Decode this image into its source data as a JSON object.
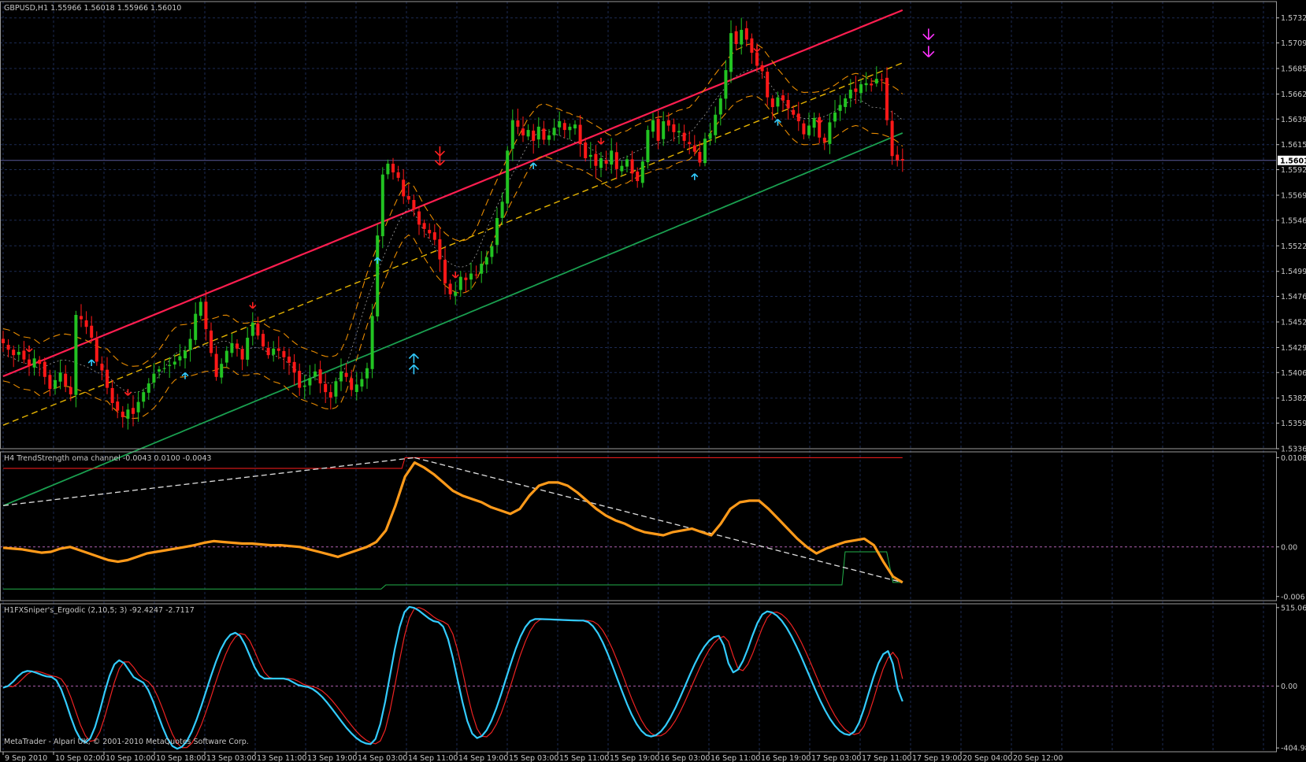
{
  "main_title": "GBPUSD,H1  1.55966 1.56018 1.55966 1.56010",
  "ind1_title": "H4 TrendStrength oma channel -0.0043 0.0100 -0.0043",
  "ind2_title": "H1FXSniper's_Ergodic  (2,10,5; 3) -92.4247 -2.7117",
  "footer": "MetaTrader - Alpari UK, © 2001-2010 MetaQuotes Software Corp.",
  "colors": {
    "background": "#000000",
    "grid": "#1c2a52",
    "axis": "#c0c0c0",
    "bull": "#22c322",
    "bear": "#ff1818",
    "ma_red": "#ff1e50",
    "ma_yellow": "#e6b400",
    "ma_green": "#1aa050",
    "band": "#e68a00",
    "midline": "#a0a0a0",
    "osc_orange": "#ff9a1a",
    "osc_level_red": "#ff1e1e",
    "osc_level_green": "#22b04a",
    "trend_white": "#e0e0e0",
    "erg_blue": "#33ccff",
    "erg_red": "#ee2222",
    "zero_line": "#b060b0",
    "up_arrow": "#33ccff",
    "down_arrow": "#ff2020",
    "magenta_arrow": "#ff33ff"
  },
  "chart_data": [
    {
      "type": "candlestick",
      "name": "GBPUSD,H1",
      "ylim": [
        1.5336,
        1.5747
      ],
      "price_ticks": [
        "1.57320",
        "1.57090",
        "1.56855",
        "1.56620",
        "1.56390",
        "1.56155",
        "1.55925",
        "1.55690",
        "1.55460",
        "1.55225",
        "1.54990",
        "1.54760",
        "1.54525",
        "1.54290",
        "1.54060",
        "1.53825",
        "1.53595",
        "1.53360"
      ],
      "current_price": "1.56010",
      "x_labels": [
        "9 Sep 2010",
        "10 Sep 02:00",
        "10 Sep 10:00",
        "10 Sep 18:00",
        "13 Sep 03:00",
        "13 Sep 11:00",
        "13 Sep 19:00",
        "14 Sep 03:00",
        "14 Sep 11:00",
        "14 Sep 19:00",
        "15 Sep 03:00",
        "15 Sep 11:00",
        "15 Sep 19:00",
        "16 Sep 03:00",
        "16 Sep 11:00",
        "16 Sep 19:00",
        "17 Sep 03:00",
        "17 Sep 11:00",
        "17 Sep 19:00",
        "20 Sep 04:00",
        "20 Sep 12:00"
      ],
      "closes": [
        1.5433,
        1.5427,
        1.5422,
        1.5425,
        1.5418,
        1.5412,
        1.5419,
        1.5414,
        1.5402,
        1.5391,
        1.5399,
        1.5406,
        1.5394,
        1.5386,
        1.5459,
        1.5455,
        1.5448,
        1.5438,
        1.5416,
        1.5408,
        1.5392,
        1.5378,
        1.5371,
        1.5365,
        1.5372,
        1.5368,
        1.5379,
        1.5388,
        1.5396,
        1.5405,
        1.5409,
        1.541,
        1.5413,
        1.5416,
        1.5421,
        1.5426,
        1.5437,
        1.546,
        1.5471,
        1.5446,
        1.5424,
        1.5402,
        1.5414,
        1.5426,
        1.5433,
        1.5428,
        1.5418,
        1.5438,
        1.5452,
        1.544,
        1.543,
        1.5422,
        1.5428,
        1.5426,
        1.542,
        1.5415,
        1.5406,
        1.5392,
        1.5394,
        1.5401,
        1.5407,
        1.5396,
        1.5388,
        1.5383,
        1.5398,
        1.5407,
        1.5402,
        1.539,
        1.5395,
        1.54,
        1.541,
        1.5458,
        1.5532,
        1.5588,
        1.5598,
        1.559,
        1.5585,
        1.5568,
        1.5565,
        1.5556,
        1.5542,
        1.5538,
        1.5534,
        1.5528,
        1.551,
        1.5488,
        1.5478,
        1.548,
        1.5494,
        1.5491,
        1.5497,
        1.5496,
        1.5506,
        1.5512,
        1.5522,
        1.5548,
        1.5563,
        1.561,
        1.5638,
        1.5632,
        1.5624,
        1.5629,
        1.5619,
        1.5632,
        1.562,
        1.5624,
        1.5631,
        1.5637,
        1.5629,
        1.5632,
        1.5634,
        1.5616,
        1.5603,
        1.5606,
        1.5596,
        1.5603,
        1.5598,
        1.561,
        1.5593,
        1.5596,
        1.5602,
        1.5589,
        1.5582,
        1.56,
        1.5629,
        1.5638,
        1.5619,
        1.5637,
        1.5633,
        1.5627,
        1.5628,
        1.5619,
        1.5616,
        1.5609,
        1.5599,
        1.5621,
        1.5626,
        1.5643,
        1.5658,
        1.5684,
        1.5718,
        1.5708,
        1.5721,
        1.5712,
        1.57,
        1.5688,
        1.5683,
        1.5659,
        1.565,
        1.5659,
        1.5656,
        1.5649,
        1.5643,
        1.5637,
        1.5625,
        1.5633,
        1.564,
        1.5622,
        1.5618,
        1.5636,
        1.5645,
        1.5652,
        1.5658,
        1.5666,
        1.5664,
        1.5671,
        1.5672,
        1.567,
        1.5676,
        1.5675,
        1.5638,
        1.5605,
        1.5601,
        1.5601
      ]
    },
    {
      "type": "line",
      "name": "H4 TrendStrength oma channel",
      "ylim": [
        -0.0065,
        0.0115
      ],
      "y_ticks": [
        "0.0108",
        "0.00",
        "-0.006"
      ],
      "levels": {
        "upper": 0.01,
        "lower": -0.0043,
        "zero": 0.0
      }
    },
    {
      "type": "line",
      "name": "H1FXSniper's_Ergodic",
      "ylim": [
        -430,
        540
      ],
      "y_ticks": [
        "515.069",
        "0.00",
        "-404.987"
      ]
    }
  ]
}
